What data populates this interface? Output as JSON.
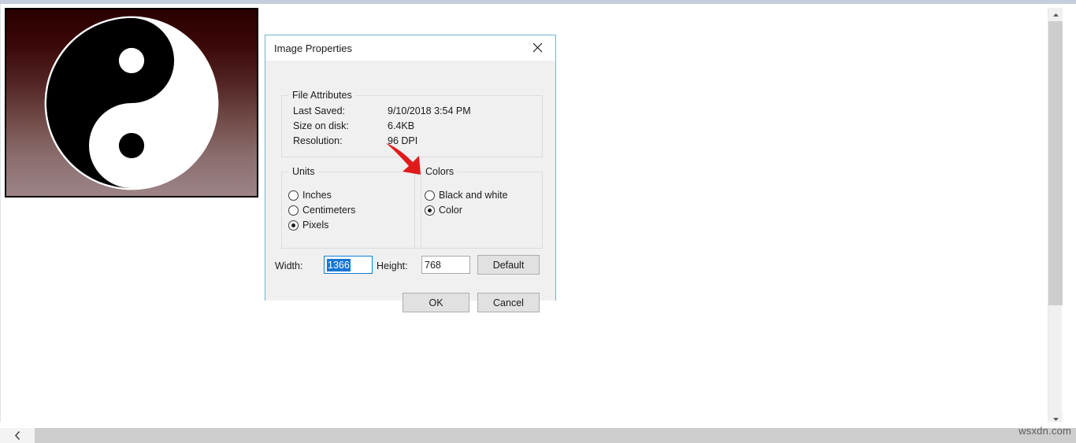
{
  "window": {
    "watermark": "wsxdn.com"
  },
  "canvas": {
    "image_name": "yin-yang-symbol",
    "background_gradient_top": "#2a0000",
    "background_gradient_bottom": "#9d8488"
  },
  "dialog": {
    "title": "Image Properties",
    "close_label": "✕",
    "file_attributes": {
      "legend": "File Attributes",
      "rows": [
        {
          "label": "Last Saved:",
          "value": "9/10/2018 3:54 PM"
        },
        {
          "label": "Size on disk:",
          "value": "6.4KB"
        },
        {
          "label": "Resolution:",
          "value": "96 DPI"
        }
      ]
    },
    "units": {
      "legend": "Units",
      "options": [
        {
          "label": "Inches",
          "selected": false
        },
        {
          "label": "Centimeters",
          "selected": false
        },
        {
          "label": "Pixels",
          "selected": true
        }
      ]
    },
    "colors": {
      "legend": "Colors",
      "options": [
        {
          "label": "Black and white",
          "selected": false
        },
        {
          "label": "Color",
          "selected": true
        }
      ]
    },
    "size": {
      "width_label": "Width:",
      "width_value": "1366",
      "height_label": "Height:",
      "height_value": "768",
      "default_label": "Default"
    },
    "actions": {
      "ok_label": "OK",
      "cancel_label": "Cancel"
    },
    "annotation": {
      "arrow_color": "#e01b1b",
      "points_at": "Black and white"
    }
  },
  "scrollbars": {
    "vertical_up": "▴",
    "vertical_down": "▾",
    "horizontal_left": "‹"
  }
}
